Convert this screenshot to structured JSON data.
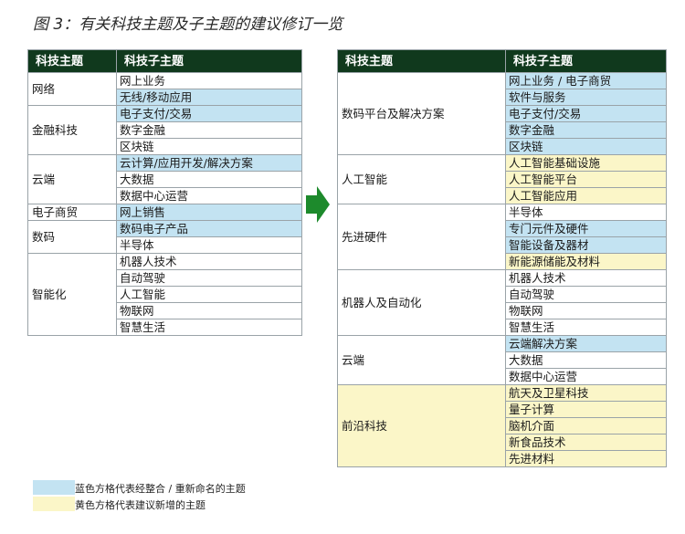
{
  "title": "图 3：有关科技主题及子主题的建议修订一览",
  "colors": {
    "header": "#10391d",
    "blue": "#c3e3f2",
    "yellow": "#fbf6c8",
    "arrow": "#1d8a2c"
  },
  "headers": {
    "topic": "科技主题",
    "subtopic": "科技子主题"
  },
  "left": [
    {
      "topic": "网络",
      "subs": [
        {
          "t": "网上业务",
          "c": ""
        },
        {
          "t": "无线/移动应用",
          "c": "blue"
        }
      ]
    },
    {
      "topic": "金融科技",
      "subs": [
        {
          "t": "电子支付/交易",
          "c": "blue"
        },
        {
          "t": "数字金融",
          "c": ""
        },
        {
          "t": "区块链",
          "c": ""
        }
      ]
    },
    {
      "topic": "云端",
      "subs": [
        {
          "t": "云计算/应用开发/解决方案",
          "c": "blue"
        },
        {
          "t": "大数据",
          "c": ""
        },
        {
          "t": "数据中心运营",
          "c": ""
        }
      ]
    },
    {
      "topic": "电子商贸",
      "subs": [
        {
          "t": "网上销售",
          "c": "blue"
        }
      ]
    },
    {
      "topic": "数码",
      "subs": [
        {
          "t": "数码电子产品",
          "c": "blue"
        },
        {
          "t": "半导体",
          "c": ""
        }
      ]
    },
    {
      "topic": "智能化",
      "subs": [
        {
          "t": "机器人技术",
          "c": ""
        },
        {
          "t": "自动驾驶",
          "c": ""
        },
        {
          "t": "人工智能",
          "c": ""
        },
        {
          "t": "物联网",
          "c": ""
        },
        {
          "t": "智慧生活",
          "c": ""
        }
      ]
    }
  ],
  "right": [
    {
      "topic": "数码平台及解决方案",
      "subs": [
        {
          "t": "网上业务 / 电子商贸",
          "c": "blue"
        },
        {
          "t": "软件与服务",
          "c": "blue"
        },
        {
          "t": "电子支付/交易",
          "c": "blue"
        },
        {
          "t": "数字金融",
          "c": "blue"
        },
        {
          "t": "区块链",
          "c": "blue"
        }
      ]
    },
    {
      "topic": "人工智能",
      "subs": [
        {
          "t": "人工智能基础设施",
          "c": "yellow"
        },
        {
          "t": "人工智能平台",
          "c": "yellow"
        },
        {
          "t": "人工智能应用",
          "c": "yellow"
        }
      ]
    },
    {
      "topic": "先进硬件",
      "subs": [
        {
          "t": "半导体",
          "c": ""
        },
        {
          "t": "专门元件及硬件",
          "c": "blue"
        },
        {
          "t": "智能设备及器材",
          "c": "blue"
        },
        {
          "t": "新能源储能及材料",
          "c": "yellow"
        }
      ]
    },
    {
      "topic": "机器人及自动化",
      "subs": [
        {
          "t": "机器人技术",
          "c": ""
        },
        {
          "t": "自动驾驶",
          "c": ""
        },
        {
          "t": "物联网",
          "c": ""
        },
        {
          "t": "智慧生活",
          "c": ""
        }
      ]
    },
    {
      "topic": "云端",
      "subs": [
        {
          "t": "云端解决方案",
          "c": "blue"
        },
        {
          "t": "大数据",
          "c": ""
        },
        {
          "t": "数据中心运营",
          "c": ""
        }
      ]
    },
    {
      "topic": "前沿科技",
      "topicColor": "yellow",
      "subs": [
        {
          "t": "航天及卫星科技",
          "c": "yellow"
        },
        {
          "t": "量子计算",
          "c": "yellow"
        },
        {
          "t": "脑机介面",
          "c": "yellow"
        },
        {
          "t": "新食品技术",
          "c": "yellow"
        },
        {
          "t": "先进材料",
          "c": "yellow"
        }
      ]
    }
  ],
  "legend": [
    {
      "color": "blue",
      "text": "蓝色方格代表经整合 / 重新命名的主题"
    },
    {
      "color": "yellow",
      "text": "黄色方格代表建议新增的主题"
    }
  ]
}
